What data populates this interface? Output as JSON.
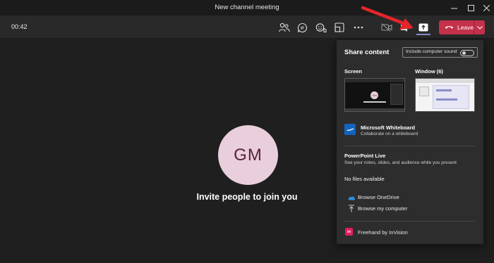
{
  "window": {
    "title": "New channel meeting"
  },
  "toolbar": {
    "timer": "00:42",
    "leave_label": "Leave"
  },
  "stage": {
    "avatar_initials": "GM",
    "invite_text": "Invite people to join you"
  },
  "share_panel": {
    "title": "Share content",
    "include_sound_label": "Include computer sound",
    "screen_label": "Screen",
    "window_label": "Window (6)",
    "whiteboard_title": "Microsoft Whiteboard",
    "whiteboard_subtitle": "Collaborate on a whiteboard",
    "ppt_title": "PowerPoint Live",
    "ppt_subtitle": "See your notes, slides, and audience while you present",
    "no_files": "No files available",
    "browse_onedrive": "Browse OneDrive",
    "browse_computer": "Browse my computer",
    "freehand": "Freehand by InVision",
    "thumb_avatar_initials": "GM"
  },
  "colors": {
    "leave_red": "#c4314b",
    "accent": "#8b8cc7",
    "arrow_red": "#e5252a",
    "avatar_bg": "#e8cfdb",
    "avatar_text": "#5a2140"
  },
  "icons": {
    "window": [
      "minimize-icon",
      "maximize-icon",
      "close-icon"
    ],
    "toolbar": [
      "participants-icon",
      "chat-icon",
      "reactions-icon",
      "rooms-icon",
      "more-options-icon",
      "camera-off-icon",
      "mic-off-icon",
      "share-tray-icon",
      "phone-hangup-icon",
      "chevron-down-icon"
    ],
    "panel": [
      "whiteboard-icon",
      "onedrive-icon",
      "upload-icon",
      "invision-icon"
    ]
  }
}
